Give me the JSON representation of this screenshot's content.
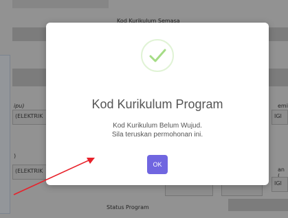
{
  "background": {
    "top_label": "Kod Kurikulum Semasa",
    "left_field_1_label": "ipu)",
    "left_field_1_value": "(ELEKTRIK",
    "right_field_1_label": "emi",
    "right_field_1_value": "IGI",
    "left_field_2_label": ")",
    "left_field_2_value": "(ELEKTRIK",
    "right_field_2_label": "an (",
    "right_field_2_value": "IGI",
    "bottom_label": "Status Program"
  },
  "modal": {
    "icon": "checkmark-success-icon",
    "title": "Kod Kurikulum Program",
    "message_line1": "Kod Kurikulum Belum Wujud.",
    "message_line2": "Sila teruskan permohonan ini.",
    "ok_label": "OK",
    "ok_color": "#7066e0",
    "success_color": "#a5dc86"
  },
  "annotation": {
    "arrow_color": "#e8212a"
  }
}
